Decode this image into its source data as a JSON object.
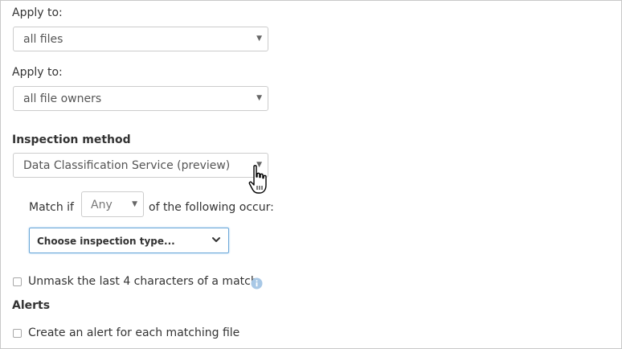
{
  "apply_to_files": {
    "label": "Apply to:",
    "value": "all files"
  },
  "apply_to_owners": {
    "label": "Apply to:",
    "value": "all file owners"
  },
  "inspection": {
    "label": "Inspection method",
    "value": "Data Classification Service (preview)"
  },
  "match": {
    "prefix": "Match if",
    "operator": "Any",
    "suffix": "of the following occur:",
    "type_placeholder": "Choose inspection type..."
  },
  "unmask": {
    "label": "Unmask the last 4 characters of a match",
    "info_icon": "info-icon",
    "info_color": "#a8c8e6"
  },
  "alerts": {
    "heading": "Alerts",
    "checkbox_label": "Create an alert for each matching file"
  },
  "icons": {
    "caret": "▼",
    "chevron": "chevron-down-icon",
    "cursor": "hand-pointer-icon"
  },
  "colors": {
    "focus_border": "#6aa7d8",
    "border": "#cccccc",
    "text": "#333333"
  }
}
